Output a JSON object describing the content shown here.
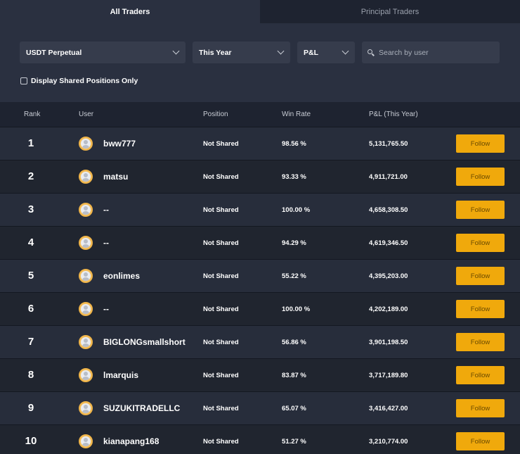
{
  "tabs": [
    {
      "label": "All Traders",
      "active": true
    },
    {
      "label": "Principal Traders",
      "active": false
    }
  ],
  "filters": {
    "contract": "USDT Perpetual",
    "period": "This Year",
    "metric": "P&L",
    "search_placeholder": "Search by user",
    "shared_only_label": "Display Shared Positions Only",
    "shared_only_checked": false
  },
  "table": {
    "headers": {
      "rank": "Rank",
      "user": "User",
      "position": "Position",
      "win_rate": "Win Rate",
      "pnl": "P&L (This Year)"
    },
    "follow_label": "Follow",
    "rows": [
      {
        "rank": "1",
        "user": "bww777",
        "position": "Not Shared",
        "win_rate": "98.56 %",
        "pnl": "5,131,765.50"
      },
      {
        "rank": "2",
        "user": "matsu",
        "position": "Not Shared",
        "win_rate": "93.33 %",
        "pnl": "4,911,721.00"
      },
      {
        "rank": "3",
        "user": "--",
        "position": "Not Shared",
        "win_rate": "100.00 %",
        "pnl": "4,658,308.50"
      },
      {
        "rank": "4",
        "user": "--",
        "position": "Not Shared",
        "win_rate": "94.29 %",
        "pnl": "4,619,346.50"
      },
      {
        "rank": "5",
        "user": "eonlimes",
        "position": "Not Shared",
        "win_rate": "55.22 %",
        "pnl": "4,395,203.00"
      },
      {
        "rank": "6",
        "user": "--",
        "position": "Not Shared",
        "win_rate": "100.00 %",
        "pnl": "4,202,189.00"
      },
      {
        "rank": "7",
        "user": "BIGLONGsmallshort",
        "position": "Not Shared",
        "win_rate": "56.86 %",
        "pnl": "3,901,198.50"
      },
      {
        "rank": "8",
        "user": "lmarquis",
        "position": "Not Shared",
        "win_rate": "83.87 %",
        "pnl": "3,717,189.80"
      },
      {
        "rank": "9",
        "user": "SUZUKITRADELLC",
        "position": "Not Shared",
        "win_rate": "65.07 %",
        "pnl": "3,416,427.00"
      },
      {
        "rank": "10",
        "user": "kianapang168",
        "position": "Not Shared",
        "win_rate": "51.27 %",
        "pnl": "3,210,774.00"
      }
    ]
  },
  "colors": {
    "accent": "#f0a90c",
    "background": "#1e2330",
    "panel": "#2a3040"
  }
}
